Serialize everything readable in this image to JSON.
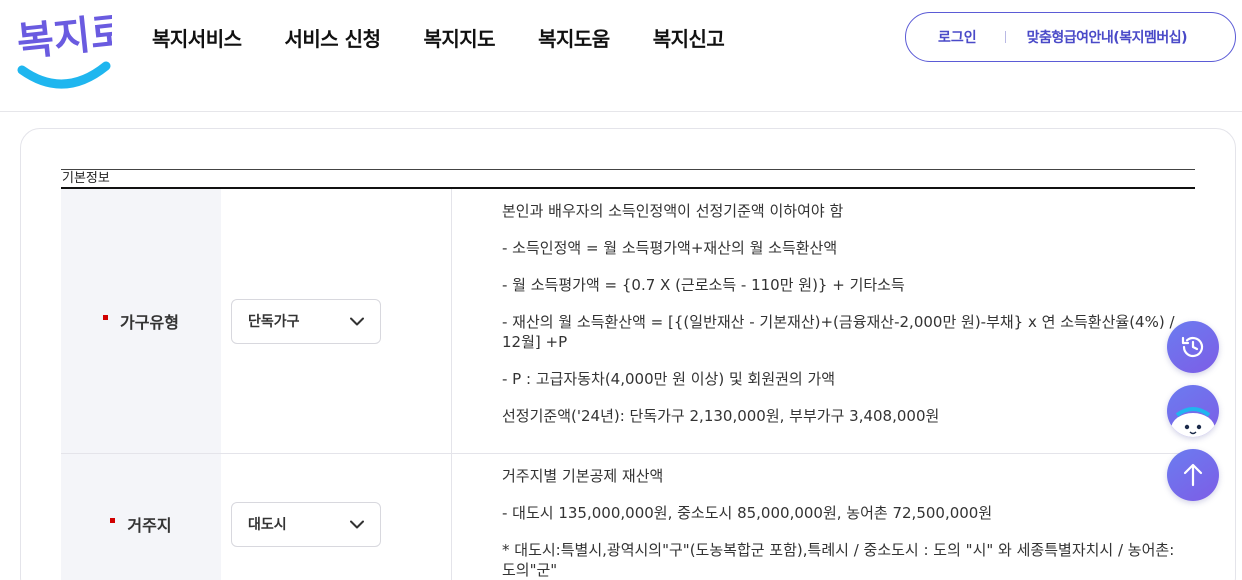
{
  "logo": {
    "text": "복지로"
  },
  "gnb": [
    {
      "label": "복지서비스"
    },
    {
      "label": "서비스 신청"
    },
    {
      "label": "복지지도"
    },
    {
      "label": "복지도움"
    },
    {
      "label": "복지신고"
    }
  ],
  "util": {
    "login": "로그인",
    "member": "맞춤형급여안내(복지멤버십)"
  },
  "table": {
    "caption": "기본정보",
    "rows": [
      {
        "label": "가구유형",
        "select_value": "단독가구",
        "lines": [
          "본인과 배우자의 소득인정액이 선정기준액 이하여야 함",
          "- 소득인정액 = 월 소득평가액+재산의 월 소득환산액",
          "- 월 소득평가액 = {0.7 X (근로소득 - 110만 원)} + 기타소득",
          "- 재산의 월 소득환산액 = [{(일반재산 - 기본재산)+(금융재산-2,000만 원)-부채} x 연 소득환산율(4%) / 12월] +P",
          "- P : 고급자동차(4,000만 원 이상) 및 회원권의 가액",
          "선정기준액('24년): 단독가구 2,130,000원, 부부가구 3,408,000원"
        ]
      },
      {
        "label": "거주지",
        "select_value": "대도시",
        "lines": [
          "거주지별 기본공제 재산액",
          "- 대도시 135,000,000원, 중소도시 85,000,000원, 농어촌 72,500,000원",
          "* 대도시:특별시,광역시의\"구\"(도농복합군 포함),특례시 / 중소도시 : 도의 \"시\" 와 세종특별자치시 / 농어촌:도의\"군\""
        ]
      }
    ]
  },
  "floating": {
    "history_icon": "history-icon",
    "chat_icon": "chatbot-mascot-icon",
    "top_icon": "arrow-up-icon"
  },
  "colors": {
    "brand_blue": "#1fb6ef",
    "brand_purple": "#5b5bd6",
    "bullet_red": "#d10000"
  }
}
